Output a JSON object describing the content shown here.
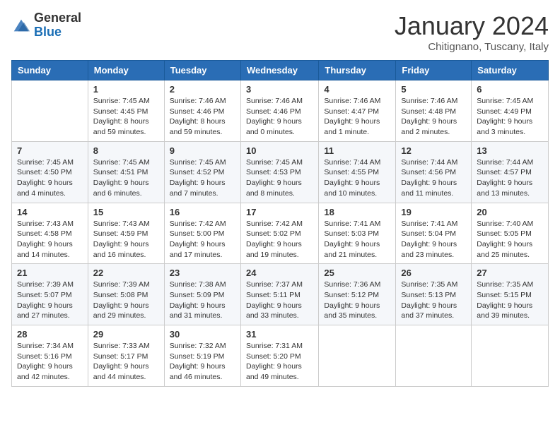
{
  "logo": {
    "general": "General",
    "blue": "Blue"
  },
  "title": "January 2024",
  "location": "Chitignano, Tuscany, Italy",
  "days_header": [
    "Sunday",
    "Monday",
    "Tuesday",
    "Wednesday",
    "Thursday",
    "Friday",
    "Saturday"
  ],
  "weeks": [
    [
      {
        "day": "",
        "info": ""
      },
      {
        "day": "1",
        "info": "Sunrise: 7:45 AM\nSunset: 4:45 PM\nDaylight: 8 hours\nand 59 minutes."
      },
      {
        "day": "2",
        "info": "Sunrise: 7:46 AM\nSunset: 4:46 PM\nDaylight: 8 hours\nand 59 minutes."
      },
      {
        "day": "3",
        "info": "Sunrise: 7:46 AM\nSunset: 4:46 PM\nDaylight: 9 hours\nand 0 minutes."
      },
      {
        "day": "4",
        "info": "Sunrise: 7:46 AM\nSunset: 4:47 PM\nDaylight: 9 hours\nand 1 minute."
      },
      {
        "day": "5",
        "info": "Sunrise: 7:46 AM\nSunset: 4:48 PM\nDaylight: 9 hours\nand 2 minutes."
      },
      {
        "day": "6",
        "info": "Sunrise: 7:45 AM\nSunset: 4:49 PM\nDaylight: 9 hours\nand 3 minutes."
      }
    ],
    [
      {
        "day": "7",
        "info": "Sunrise: 7:45 AM\nSunset: 4:50 PM\nDaylight: 9 hours\nand 4 minutes."
      },
      {
        "day": "8",
        "info": "Sunrise: 7:45 AM\nSunset: 4:51 PM\nDaylight: 9 hours\nand 6 minutes."
      },
      {
        "day": "9",
        "info": "Sunrise: 7:45 AM\nSunset: 4:52 PM\nDaylight: 9 hours\nand 7 minutes."
      },
      {
        "day": "10",
        "info": "Sunrise: 7:45 AM\nSunset: 4:53 PM\nDaylight: 9 hours\nand 8 minutes."
      },
      {
        "day": "11",
        "info": "Sunrise: 7:44 AM\nSunset: 4:55 PM\nDaylight: 9 hours\nand 10 minutes."
      },
      {
        "day": "12",
        "info": "Sunrise: 7:44 AM\nSunset: 4:56 PM\nDaylight: 9 hours\nand 11 minutes."
      },
      {
        "day": "13",
        "info": "Sunrise: 7:44 AM\nSunset: 4:57 PM\nDaylight: 9 hours\nand 13 minutes."
      }
    ],
    [
      {
        "day": "14",
        "info": "Sunrise: 7:43 AM\nSunset: 4:58 PM\nDaylight: 9 hours\nand 14 minutes."
      },
      {
        "day": "15",
        "info": "Sunrise: 7:43 AM\nSunset: 4:59 PM\nDaylight: 9 hours\nand 16 minutes."
      },
      {
        "day": "16",
        "info": "Sunrise: 7:42 AM\nSunset: 5:00 PM\nDaylight: 9 hours\nand 17 minutes."
      },
      {
        "day": "17",
        "info": "Sunrise: 7:42 AM\nSunset: 5:02 PM\nDaylight: 9 hours\nand 19 minutes."
      },
      {
        "day": "18",
        "info": "Sunrise: 7:41 AM\nSunset: 5:03 PM\nDaylight: 9 hours\nand 21 minutes."
      },
      {
        "day": "19",
        "info": "Sunrise: 7:41 AM\nSunset: 5:04 PM\nDaylight: 9 hours\nand 23 minutes."
      },
      {
        "day": "20",
        "info": "Sunrise: 7:40 AM\nSunset: 5:05 PM\nDaylight: 9 hours\nand 25 minutes."
      }
    ],
    [
      {
        "day": "21",
        "info": "Sunrise: 7:39 AM\nSunset: 5:07 PM\nDaylight: 9 hours\nand 27 minutes."
      },
      {
        "day": "22",
        "info": "Sunrise: 7:39 AM\nSunset: 5:08 PM\nDaylight: 9 hours\nand 29 minutes."
      },
      {
        "day": "23",
        "info": "Sunrise: 7:38 AM\nSunset: 5:09 PM\nDaylight: 9 hours\nand 31 minutes."
      },
      {
        "day": "24",
        "info": "Sunrise: 7:37 AM\nSunset: 5:11 PM\nDaylight: 9 hours\nand 33 minutes."
      },
      {
        "day": "25",
        "info": "Sunrise: 7:36 AM\nSunset: 5:12 PM\nDaylight: 9 hours\nand 35 minutes."
      },
      {
        "day": "26",
        "info": "Sunrise: 7:35 AM\nSunset: 5:13 PM\nDaylight: 9 hours\nand 37 minutes."
      },
      {
        "day": "27",
        "info": "Sunrise: 7:35 AM\nSunset: 5:15 PM\nDaylight: 9 hours\nand 39 minutes."
      }
    ],
    [
      {
        "day": "28",
        "info": "Sunrise: 7:34 AM\nSunset: 5:16 PM\nDaylight: 9 hours\nand 42 minutes."
      },
      {
        "day": "29",
        "info": "Sunrise: 7:33 AM\nSunset: 5:17 PM\nDaylight: 9 hours\nand 44 minutes."
      },
      {
        "day": "30",
        "info": "Sunrise: 7:32 AM\nSunset: 5:19 PM\nDaylight: 9 hours\nand 46 minutes."
      },
      {
        "day": "31",
        "info": "Sunrise: 7:31 AM\nSunset: 5:20 PM\nDaylight: 9 hours\nand 49 minutes."
      },
      {
        "day": "",
        "info": ""
      },
      {
        "day": "",
        "info": ""
      },
      {
        "day": "",
        "info": ""
      }
    ]
  ]
}
